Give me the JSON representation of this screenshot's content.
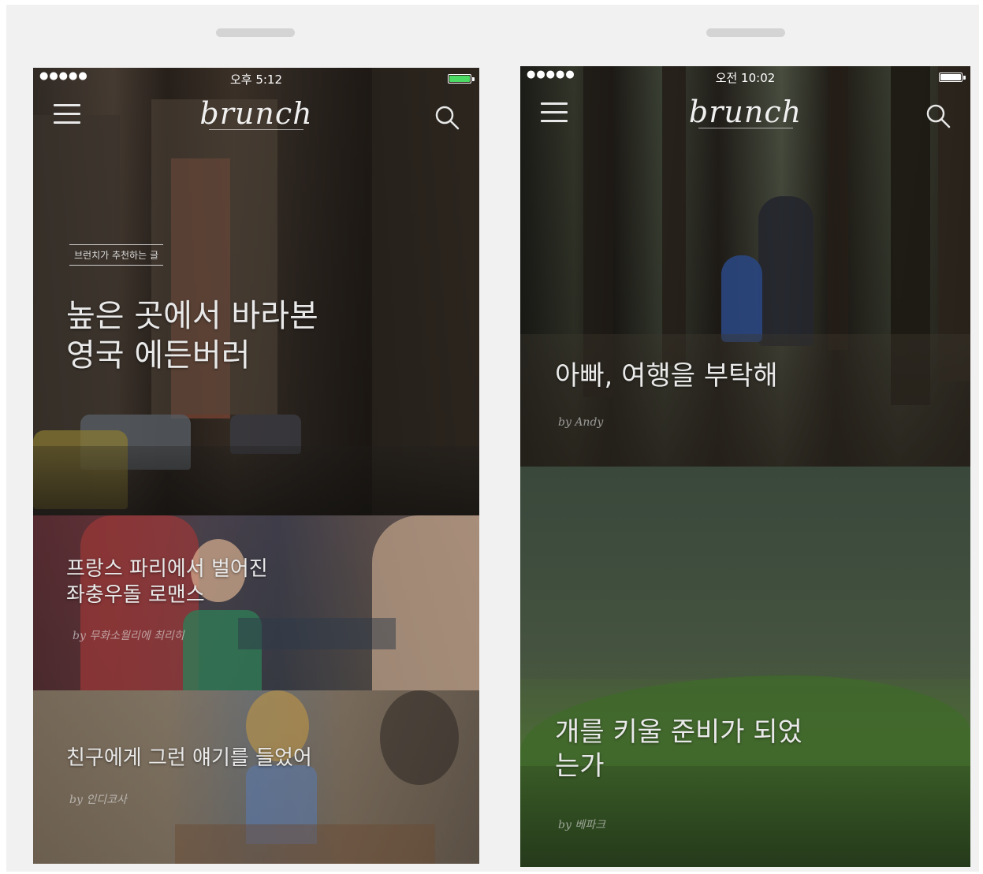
{
  "left_phone": {
    "status": {
      "signal": "●●●●●",
      "time": "오후 5:12",
      "battery_color": "#4cd964"
    },
    "logo": "brunch",
    "featured": {
      "tag": "브런치가 추천하는 글",
      "title_line1": "높은 곳에서 바라본",
      "title_line2": "영국 에든버러"
    },
    "card2": {
      "title_line1": "프랑스 파리에서 벌어진",
      "title_line2": "좌충우돌 로맨스",
      "byline": "by 무화소월리에 최리히"
    },
    "card3": {
      "title": "친구에게 그런 얘기를 들었어",
      "byline": "by 인디코사"
    }
  },
  "right_phone": {
    "status": {
      "signal": "●●●●●",
      "time": "오전 10:02",
      "battery_color": "#ffffff"
    },
    "logo": "brunch",
    "card1": {
      "title": "아빠, 여행을 부탁해",
      "byline": "by Andy"
    },
    "card2": {
      "title_line1": "개를 키울 준비가 되었",
      "title_line2": "는가",
      "byline": "by 베파크"
    }
  },
  "icons": [
    "menu-icon",
    "search-icon",
    "battery-icon"
  ]
}
